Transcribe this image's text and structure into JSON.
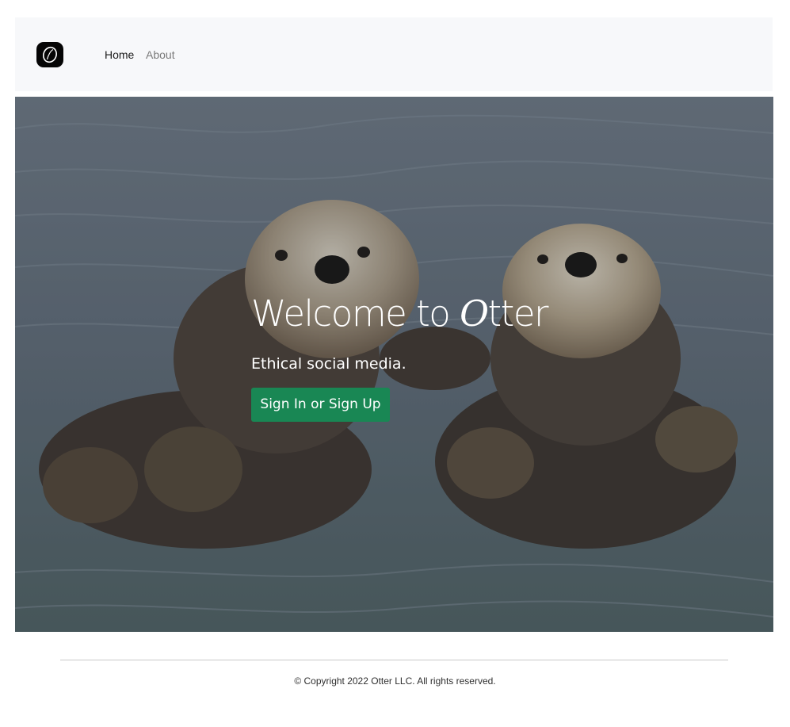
{
  "nav": {
    "logo_icon": "otter-logo-icon",
    "items": [
      {
        "label": "Home",
        "active": true
      },
      {
        "label": "About",
        "active": false
      }
    ]
  },
  "hero": {
    "title_prefix": "Welcome to ",
    "title_brand_first": "O",
    "title_brand_rest": "tter",
    "subtitle": "Ethical social media.",
    "cta_label": "Sign In or Sign Up",
    "background_image": "two sea otters floating on their backs holding paws in water"
  },
  "footer": {
    "copyright": "© Copyright 2022 Otter LLC. All rights reserved."
  },
  "colors": {
    "navbar_bg": "#f7f8fa",
    "cta_green": "#198754",
    "nav_active": "#1b1b1b",
    "nav_inactive": "#7a7a7a"
  }
}
